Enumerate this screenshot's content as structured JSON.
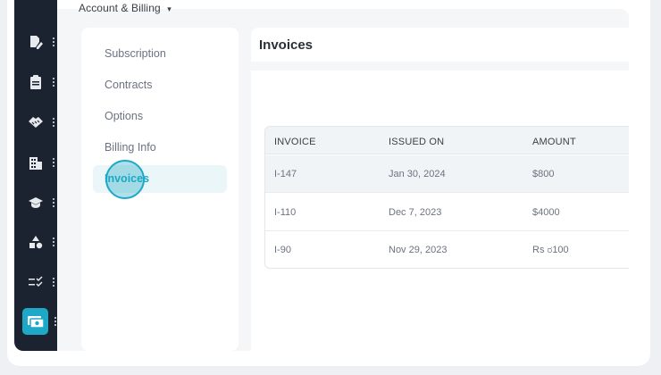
{
  "breadcrumb": {
    "label": "Account & Billing",
    "chevron": "chevron-down-icon"
  },
  "rail": {
    "items": [
      {
        "icon": "document-edit-icon",
        "active": false
      },
      {
        "icon": "clipboard-icon",
        "active": false
      },
      {
        "icon": "handshake-icon",
        "active": false
      },
      {
        "icon": "building-icon",
        "active": false
      },
      {
        "icon": "graduation-cap-icon",
        "active": false
      },
      {
        "icon": "shapes-icon",
        "active": false
      },
      {
        "icon": "list-check-icon",
        "active": false
      },
      {
        "icon": "money-bill-icon",
        "active": true
      }
    ]
  },
  "nav": {
    "items": [
      {
        "label": "Subscription"
      },
      {
        "label": "Contracts"
      },
      {
        "label": "Options"
      },
      {
        "label": "Billing Info"
      }
    ],
    "active": {
      "label": "Invoices"
    }
  },
  "panel": {
    "title": "Invoices"
  },
  "table": {
    "headers": [
      "INVOICE",
      "ISSUED ON",
      "AMOUNT"
    ],
    "rows": [
      {
        "invoice": "I-147",
        "issued_on": "Jan 30, 2024",
        "amount": "$800"
      },
      {
        "invoice": "I-110",
        "issued_on": "Dec 7, 2023",
        "amount": "$4000"
      },
      {
        "invoice": "I-90",
        "issued_on": "Nov 29, 2023",
        "amount": "Rs ರ100"
      }
    ]
  },
  "colors": {
    "accent": "#1ea8c7",
    "rail": "#1c2330"
  }
}
